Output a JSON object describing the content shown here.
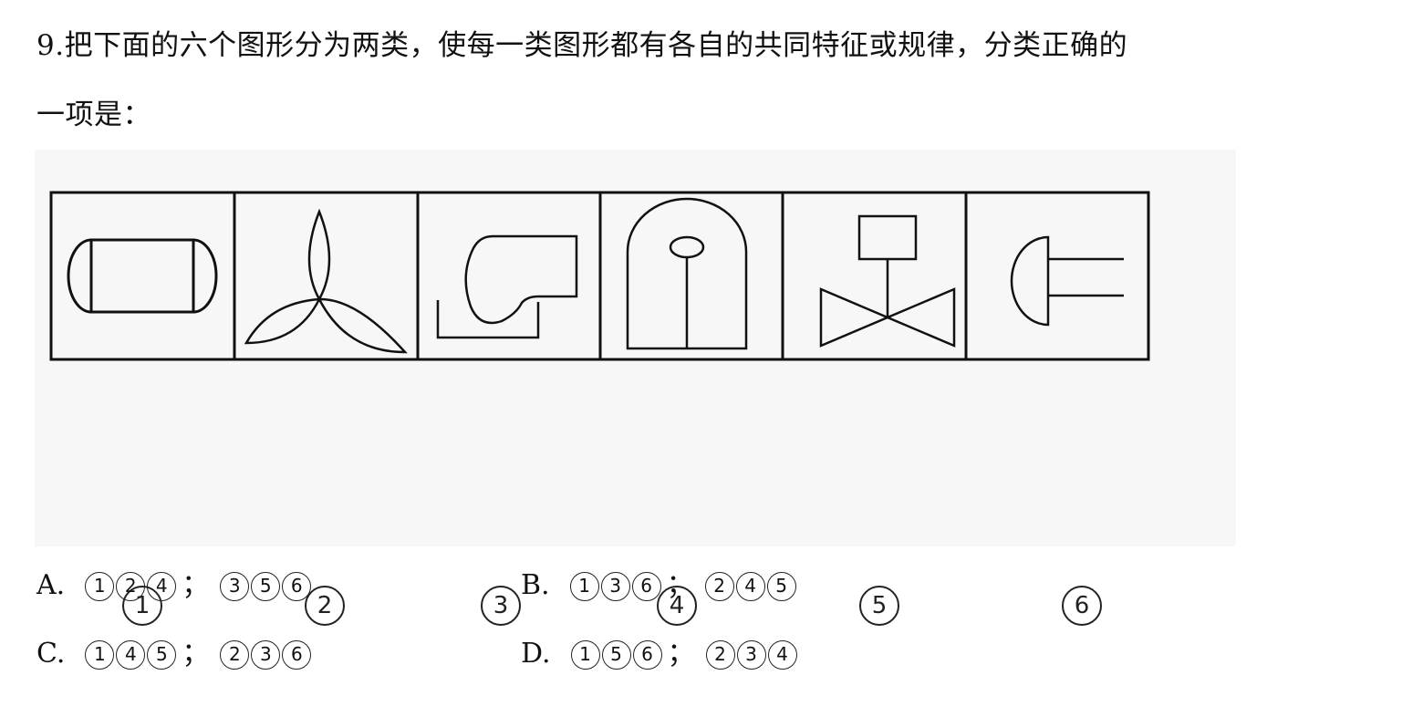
{
  "question": {
    "line1": "9.把下面的六个图形分为两类，使每一类图形都有各自的共同特征或规律，分类正确的",
    "line2": "一项是："
  },
  "figure_labels": [
    "1",
    "2",
    "3",
    "4",
    "5",
    "6"
  ],
  "options": [
    {
      "letter": "A.",
      "group1": [
        "1",
        "2",
        "4"
      ],
      "group2": [
        "3",
        "5",
        "6"
      ],
      "separator": "；"
    },
    {
      "letter": "B.",
      "group1": [
        "1",
        "3",
        "6"
      ],
      "group2": [
        "2",
        "4",
        "5"
      ],
      "separator": "；"
    },
    {
      "letter": "C.",
      "group1": [
        "1",
        "4",
        "5"
      ],
      "group2": [
        "2",
        "3",
        "6"
      ],
      "separator": "；"
    },
    {
      "letter": "D.",
      "group1": [
        "1",
        "5",
        "6"
      ],
      "group2": [
        "2",
        "3",
        "4"
      ],
      "separator": "；"
    }
  ]
}
